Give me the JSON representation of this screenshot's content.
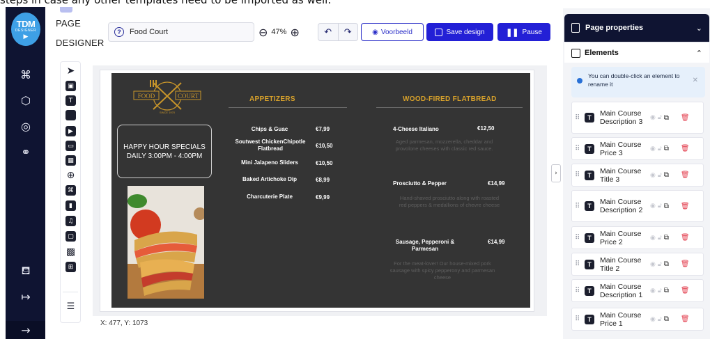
{
  "caption_fragment": "steps in case any other templates need to be imported as well.",
  "logo": {
    "line1": "TDM",
    "line2": "DESIGNER",
    "line3": "▶"
  },
  "rail": {
    "icons": [
      "apps-grid-icon",
      "cube-icon",
      "palette-icon",
      "sources-icon",
      "notifications-icon",
      "logout-icon",
      "arrow-right-icon"
    ]
  },
  "editor": {
    "section_label_1": "PAGE",
    "section_label_2": "DESIGNER",
    "design_name": "Food Court",
    "zoom_level": "47%",
    "preview_label": "Voorbeeld",
    "save_label": "Save design",
    "pause_label": "Pause",
    "coords": "X: 477, Y: 1073"
  },
  "menu": {
    "happy_hour_line1": "HAPPY HOUR SPECIALS",
    "happy_hour_line2": "DAILY 3:00PM - 4:00PM",
    "logo_word_left": "FOOD",
    "logo_word_right": "COURT",
    "logo_sub": "SINCE 1970",
    "appetizers_title": "APPETIZERS",
    "flatbread_title": "WOOD-FIRED FLATBREAD",
    "appetizers": [
      {
        "name": "Chips & Guac",
        "price": "€7,99"
      },
      {
        "name": "Soutwest ChickenChipotle Flatbread",
        "price": "€10,50"
      },
      {
        "name": "Mini Jalapeno Sliders",
        "price": "€10,50"
      },
      {
        "name": "Baked Artichoke Dip",
        "price": "€8,99"
      },
      {
        "name": "Charcuterie Plate",
        "price": "€9,99"
      }
    ],
    "flatbreads": [
      {
        "name": "4-Cheese Italiano",
        "price": "€12,50",
        "desc": "Aged parmesan, mozzerella, cheddar and provolone cheeses with classic red sauce."
      },
      {
        "name": "Prosciutto & Pepper",
        "price": "€14,99",
        "desc": "Hand-shaved prosciutto along with roasted red peppers & medallions of chevre cheese"
      },
      {
        "name": "Sausage, Pepperoni & Parmesan",
        "price": "€14,99",
        "desc": "For the meat-lover! Our house-mixed pork sausage with spicy pepperony and parmesan cheese"
      }
    ]
  },
  "panel": {
    "title": "Page properties",
    "elements_title": "Elements",
    "hint": "You can double-click an element to rename it",
    "elements": [
      "Main Course Description 3",
      "Main Course Price 3",
      "Main Course Title 3",
      "Main Course Description 2",
      "Main Course Price 2",
      "Main Course Title 2",
      "Main Course Description 1",
      "Main Course Price 1"
    ]
  }
}
